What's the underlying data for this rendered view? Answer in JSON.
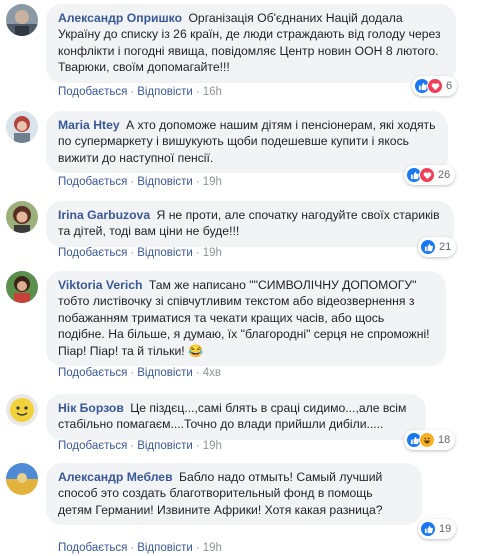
{
  "actions": {
    "like": "Подобається",
    "reply": "Відповісти",
    "separator": "·"
  },
  "colors": {
    "name": "#385898",
    "bubble": "#f2f3f5",
    "like": "#1877f2",
    "love": "#f33e58",
    "haha": "#f7b125"
  },
  "comments": [
    {
      "author": "Александр Опришко",
      "text": "Організація Об'єднаних Націй додала Україну до списку із 26 країн, де люди страждають від голоду через конфлікти і погодні явища, повідомляє Центр новин ООН 8 лютого. Тварюки, своїм допомагайте!!!",
      "time": "16h",
      "reactions": [
        "like-icon",
        "love-icon"
      ],
      "count": "6"
    },
    {
      "author": "Maria Htey",
      "text": "А хто допоможе нашим дітям і пенсіонерам, які ходять по супермаркету і вишукують щоби подешевше купити і якось вижити до наступної пенсії.",
      "time": "19h",
      "reactions": [
        "like-icon",
        "love-icon"
      ],
      "count": "26"
    },
    {
      "author": "Irina Garbuzova",
      "text": "Я не проти, але спочатку нагодуйте своїх стариків та дітей, тоді вам ціни не буде!!!",
      "time": "19h",
      "reactions": [
        "like-icon"
      ],
      "count": "21"
    },
    {
      "author": "Viktoria Verich",
      "text": "Там же написано \"\"СИМВОЛІЧНУ ДОПОМОГУ\" тобто листівочку зі співчутливим текстом або відеозвернення з побажанням триматися та чекати кращих часів, або щось подібне. На більше, я думаю, їх \"благородні\" серця не спроможні! Піар! Піар! та й тільки! 😂",
      "time": "4хв",
      "reactions": [],
      "count": ""
    },
    {
      "author": "Нік Борзов",
      "text": "Це піздєц...,самі блять в сраці сидимо...,але всім стабільно помагаєм....Точно до влади прийшли дибіли.....",
      "time": "19h",
      "reactions": [
        "like-icon",
        "haha-icon"
      ],
      "count": "18"
    },
    {
      "author": "Александр Меблев",
      "text": "Бабло надо отмыть! Самый лучший способ это создать благотворительный фонд в помощь детям Германии! Извините Африки! Хотя какая разница?",
      "time": "19h",
      "reactions": [
        "like-icon"
      ],
      "count": "19"
    }
  ]
}
